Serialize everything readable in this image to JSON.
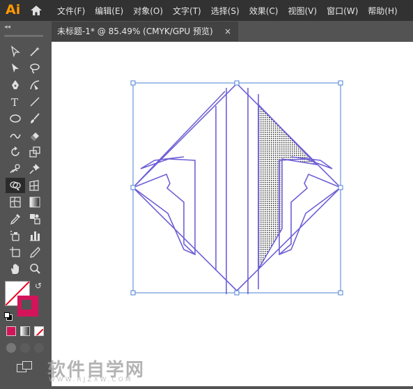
{
  "app": {
    "logo": "Ai"
  },
  "menu": [
    "文件(F)",
    "编辑(E)",
    "对象(O)",
    "文字(T)",
    "选择(S)",
    "效果(C)",
    "视图(V)",
    "窗口(W)",
    "帮助(H)"
  ],
  "document_tab": {
    "title": "未标题-1* @ 85.49% (CMYK/GPU 预览)",
    "close": "×"
  },
  "toolbar": {
    "collapse": "◂◂",
    "tools": [
      "selection-tool",
      "magic-wand-tool",
      "direct-selection-tool",
      "lasso-tool",
      "pen-tool",
      "curvature-tool",
      "type-tool",
      "line-segment-tool",
      "ellipse-tool",
      "paintbrush-tool",
      "shaper-tool",
      "eraser-tool",
      "rotate-tool",
      "scale-tool",
      "puppet-warp-tool",
      "pin-tool",
      "shape-builder-tool",
      "perspective-grid-tool",
      "mesh-tool",
      "gradient-tool",
      "eyedropper-tool",
      "blend-tool",
      "symbol-sprayer-tool",
      "column-graph-tool",
      "artboard-tool",
      "slice-tool",
      "hand-tool",
      "zoom-tool"
    ],
    "selected_tool": "shape-builder-tool",
    "fill_color": "none",
    "stroke_color": "#d4145a"
  },
  "artwork": {
    "stroke_color": "#6e5fd6",
    "bbox_color": "#4a7fd4"
  },
  "watermark": {
    "text": "软件自学网",
    "url": "WWW.RJZXW.COM"
  }
}
